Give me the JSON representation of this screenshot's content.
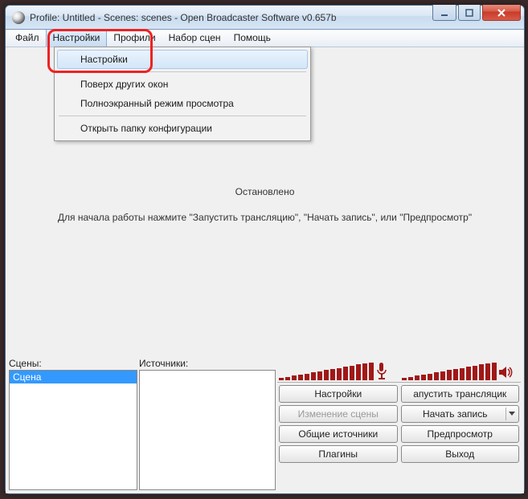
{
  "titlebar": {
    "title": "Profile: Untitled - Scenes: scenes - Open Broadcaster Software v0.657b"
  },
  "menubar": {
    "file": "Файл",
    "settings": "Настройки",
    "profiles": "Профили",
    "scene_collection": "Набор сцен",
    "help": "Помощь"
  },
  "settings_menu": {
    "settings": "Настройки",
    "always_on_top": "Поверх других окон",
    "fullscreen_preview": "Полноэкранный режим просмотра",
    "open_config_folder": "Открыть папку конфигурации"
  },
  "preview": {
    "status": "Остановлено",
    "hint": "Для начала работы нажмите \"Запустить трансляцию\", \"Начать запись\", или \"Предпросмотр\""
  },
  "panels": {
    "scenes_label": "Сцены:",
    "sources_label": "Источники:",
    "scenes": [
      "Сцена"
    ]
  },
  "buttons": {
    "settings": "Настройки",
    "start_stream": "апустить трансляцик",
    "scene_edit": "Изменение сцены",
    "start_record": "Начать запись",
    "global_sources": "Общие источники",
    "preview": "Предпросмотр",
    "plugins": "Плагины",
    "exit": "Выход"
  },
  "meters": {
    "mic_levels": [
      2,
      3,
      4,
      5,
      6,
      7,
      8,
      9,
      10,
      11,
      12,
      13,
      14,
      15,
      16
    ],
    "spk_levels": [
      2,
      3,
      4,
      5,
      6,
      7,
      8,
      9,
      10,
      11,
      12,
      13,
      14,
      15,
      16
    ]
  }
}
